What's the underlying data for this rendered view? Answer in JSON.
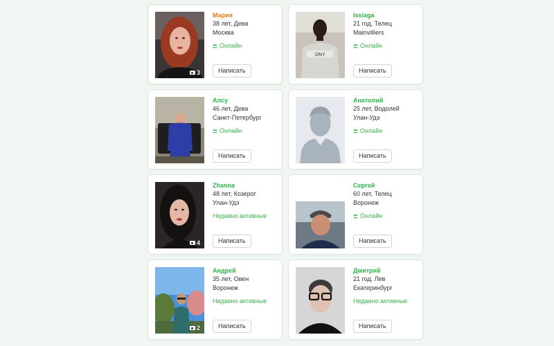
{
  "button_label": "Написать",
  "colors": {
    "name_green": "#2fb44a",
    "name_orange": "#f07a1a",
    "status_green": "#3bb54a"
  },
  "profiles": [
    {
      "name": "Мария",
      "age_sign": "38 лет, Дева",
      "city": "Москва",
      "status": "Онлайн",
      "online": true,
      "photo_count": "3",
      "photo": "woman-red-hair"
    },
    {
      "name": "Issiaga",
      "age_sign": "21 год, Телец",
      "city": "Mainvilliers",
      "status": "Онлайн",
      "online": true,
      "photo_count": "",
      "photo": "man-dark-hoodie"
    },
    {
      "name": "Алсу",
      "age_sign": "46 лет, Дева",
      "city": "Санкт-Петербург",
      "status": "Онлайн",
      "online": true,
      "photo_count": "",
      "photo": "woman-blue-dress"
    },
    {
      "name": "Анатолий",
      "age_sign": "25 лет, Водолей",
      "city": "Улан-Удэ",
      "status": "Онлайн",
      "online": true,
      "photo_count": "",
      "photo": "placeholder-avatar"
    },
    {
      "name": "Zhanna",
      "age_sign": "48 лет, Козерог",
      "city": "Улан-Удэ",
      "status": "Недавно активные",
      "online": false,
      "photo_count": "4",
      "photo": "woman-dark-hair"
    },
    {
      "name": "Сергей",
      "age_sign": "60 лет, Телец",
      "city": "Воронеж",
      "status": "Онлайн",
      "online": true,
      "photo_count": "",
      "photo": "man-cap"
    },
    {
      "name": "Андрей",
      "age_sign": "35 лет, Овен",
      "city": "Воронеж",
      "status": "Недавно активные",
      "online": false,
      "photo_count": "2",
      "photo": "man-outdoors"
    },
    {
      "name": "Дмитрий",
      "age_sign": "21 год, Лев",
      "city": "Екатеринбург",
      "status": "Недавно активные",
      "online": false,
      "photo_count": "",
      "photo": "man-glasses"
    }
  ]
}
